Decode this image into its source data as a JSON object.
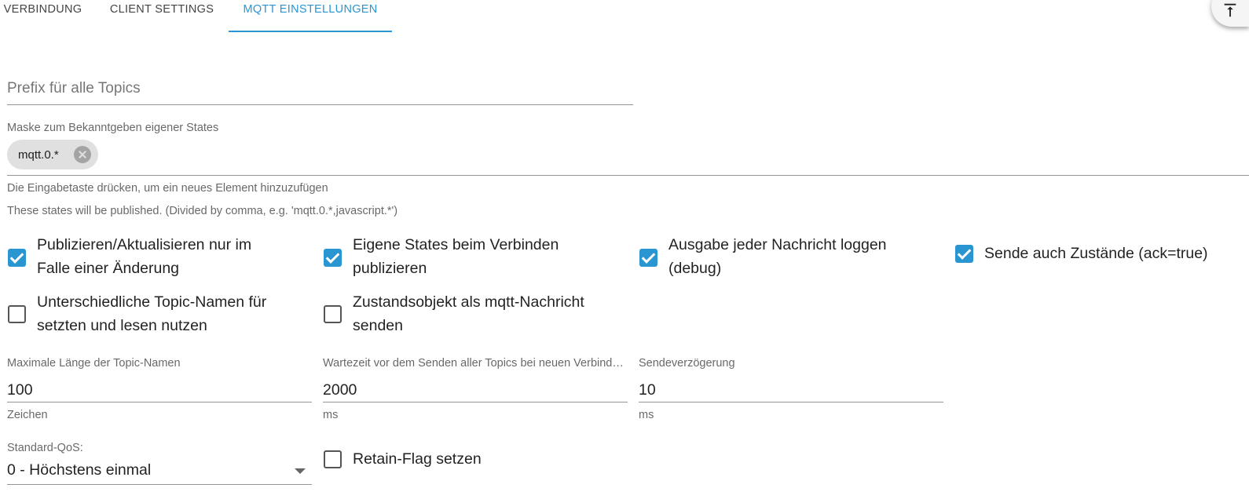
{
  "tabs": [
    {
      "label": "VERBINDUNG",
      "active": false
    },
    {
      "label": "CLIENT SETTINGS",
      "active": false
    },
    {
      "label": "MQTT EINSTELLUNGEN",
      "active": true
    }
  ],
  "accent_color": "#2a96d1",
  "fab": {
    "icon": "vertical-align-top-icon"
  },
  "prefix": {
    "placeholder": "Prefix für alle Topics",
    "value": ""
  },
  "mask": {
    "label": "Maske zum Bekanntgeben eigener States",
    "chips": [
      {
        "value": "mqtt.0.*"
      }
    ],
    "helper_hint": "Die Eingabetaste drücken, um ein neues Element hinzuzufügen",
    "helper_desc": "These states will be published. (Divided by comma, e.g. 'mqtt.0.*,javascript.*')"
  },
  "checkboxes": {
    "publish_on_change": {
      "line1": "Publizieren/Aktualisieren nur im",
      "line2": "Falle einer Änderung",
      "checked": true
    },
    "publish_own_on_connect": {
      "line1": "Eigene States beim Verbinden",
      "line2": "publizieren",
      "checked": true
    },
    "debug_log": {
      "line1": "Ausgabe jeder Nachricht loggen",
      "line2": "(debug)",
      "checked": true
    },
    "send_ack_true": {
      "line1": "Sende auch Zustände (ack=true)",
      "checked": true
    },
    "different_topic_names": {
      "line1": "Unterschiedliche Topic-Namen für",
      "line2": "setzten und lesen nutzen",
      "checked": false
    },
    "state_object_as_message": {
      "line1": "Zustandsobjekt als mqtt-Nachricht",
      "line2": "senden",
      "checked": false
    },
    "retain_flag": {
      "line1": "Retain-Flag setzen",
      "checked": false
    }
  },
  "fields": {
    "max_topic_length": {
      "label": "Maximale Länge der Topic-Namen",
      "value": "100",
      "unit": "Zeichen"
    },
    "wait_before_send": {
      "label": "Wartezeit vor dem Senden aller Topics bei neuen Verbindungen",
      "value": "2000",
      "unit": "ms"
    },
    "send_delay": {
      "label": "Sendeverzögerung",
      "value": "10",
      "unit": "ms"
    }
  },
  "qos": {
    "label": "Standard-QoS:",
    "value": "0 - Höchstens einmal"
  }
}
